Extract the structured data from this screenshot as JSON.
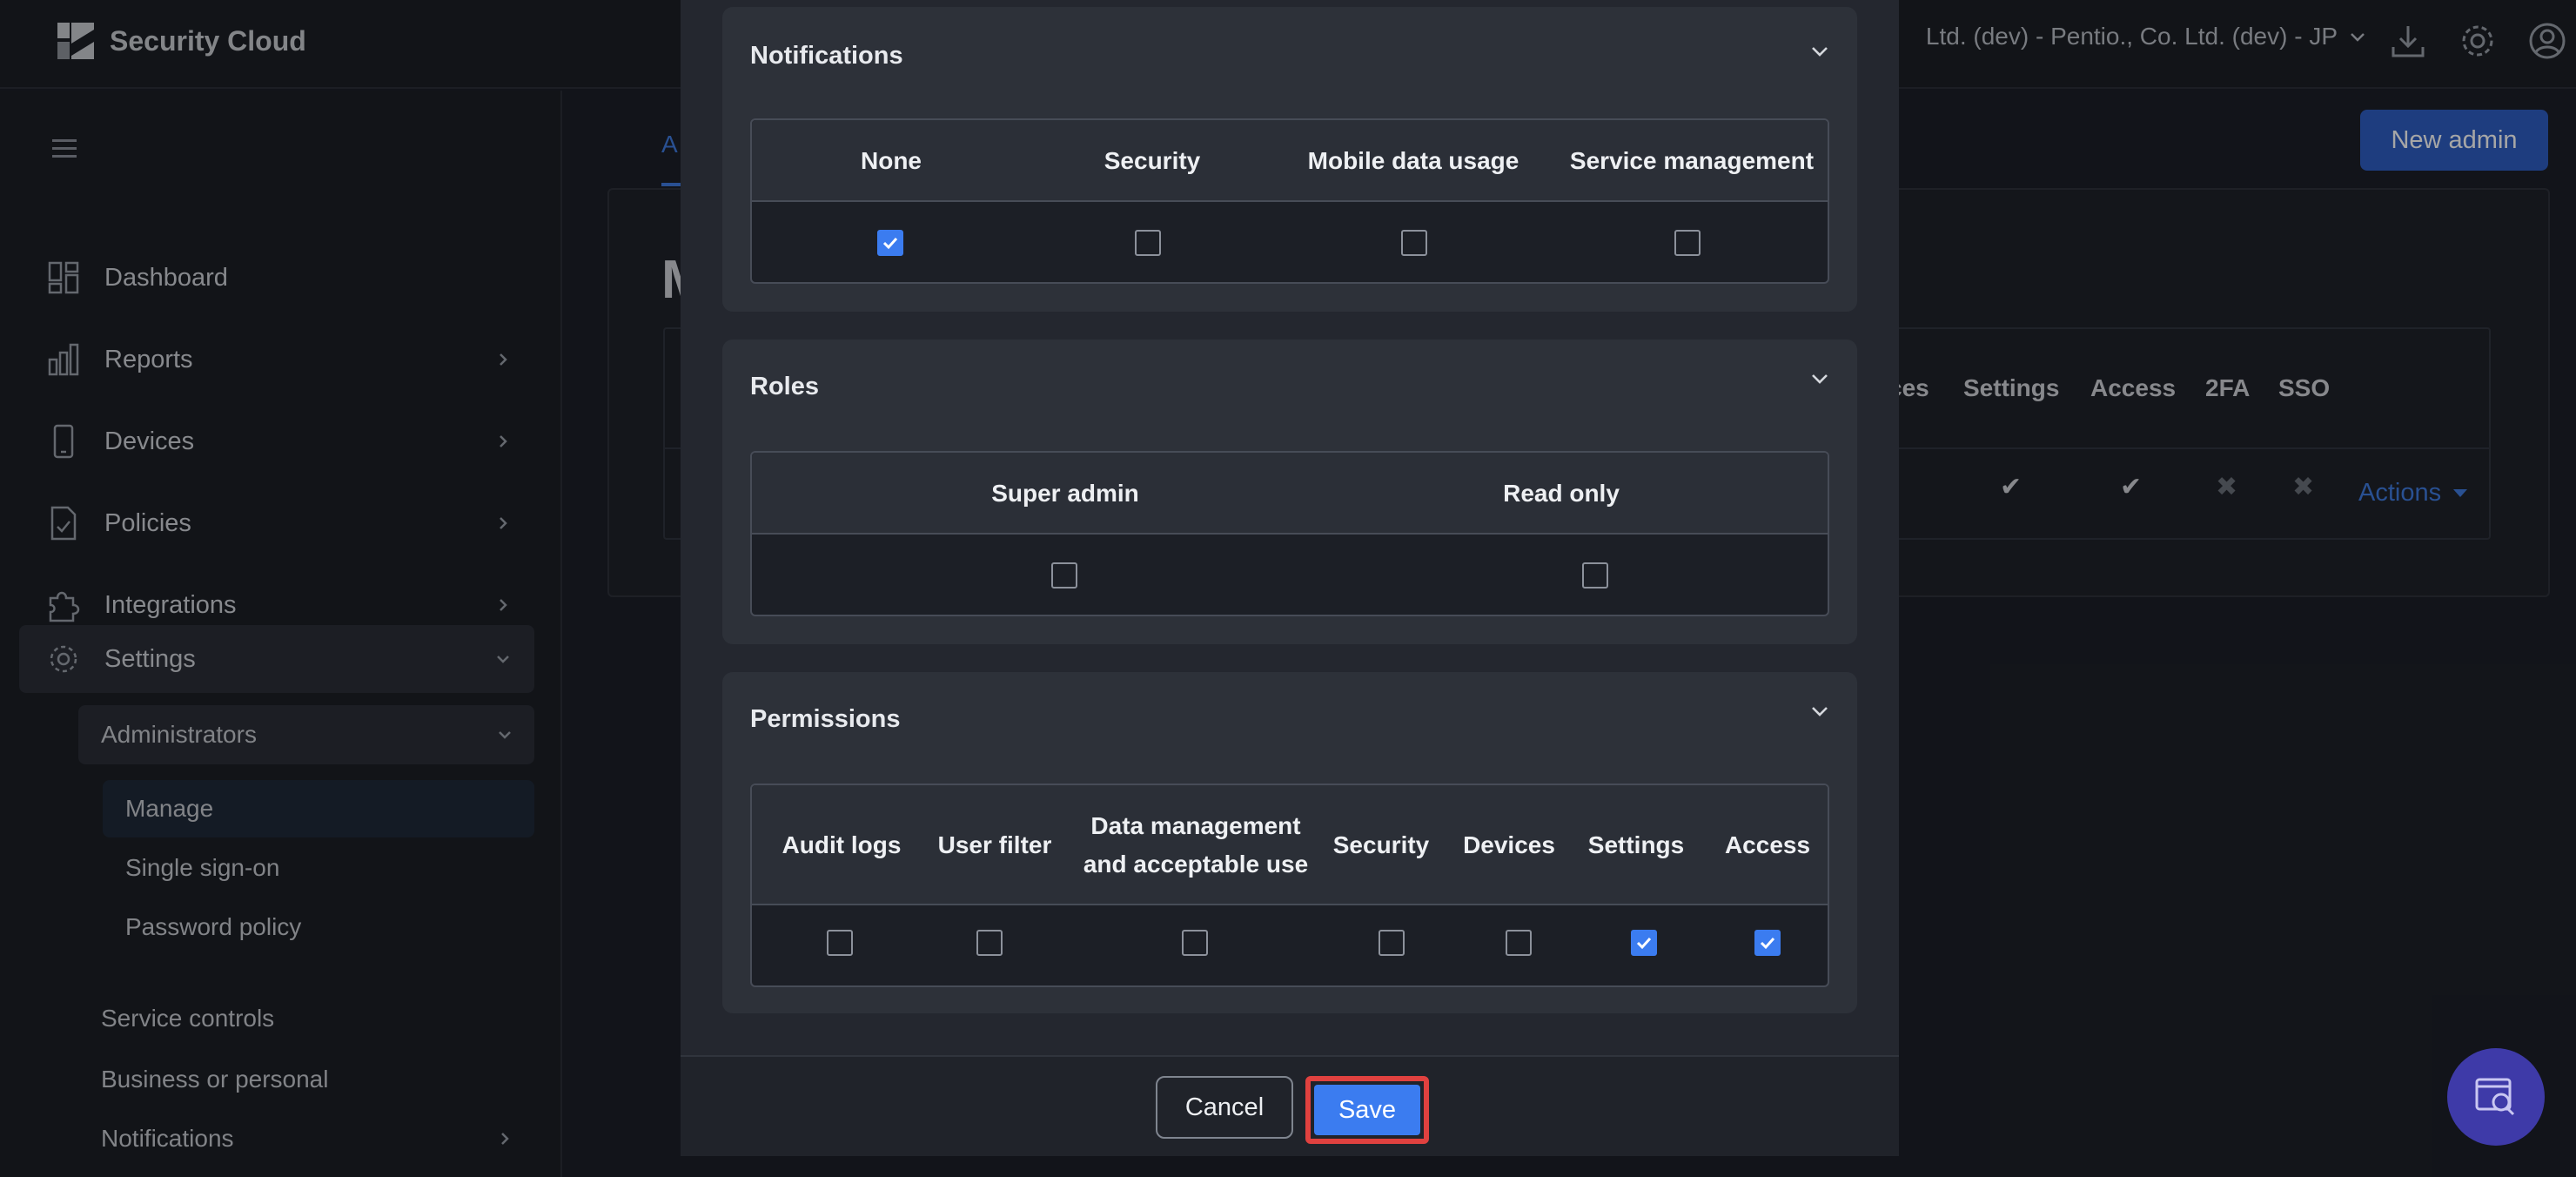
{
  "app": {
    "title": "Security Cloud"
  },
  "header": {
    "tenant": "Ltd. (dev) - Pentio., Co. Ltd. (dev) - JP"
  },
  "sidebar": {
    "items": [
      {
        "label": "Dashboard"
      },
      {
        "label": "Reports"
      },
      {
        "label": "Devices"
      },
      {
        "label": "Policies"
      },
      {
        "label": "Integrations"
      },
      {
        "label": "Settings"
      }
    ],
    "administrators": "Administrators",
    "admin_children": [
      "Manage",
      "Single sign-on",
      "Password policy"
    ],
    "more": [
      "Service controls",
      "Business or personal",
      "Notifications"
    ]
  },
  "main": {
    "tab": "A",
    "new_admin": "New admin",
    "title_fragment": "M",
    "columns": [
      "ces",
      "Settings",
      "Access",
      "2FA",
      "SSO"
    ],
    "row_marks": [
      "✔",
      "✔",
      "✖",
      "✖"
    ],
    "actions": "Actions"
  },
  "modal": {
    "notifications": {
      "title": "Notifications",
      "columns": [
        "None",
        "Security",
        "Mobile data usage",
        "Service management"
      ],
      "checked": [
        true,
        false,
        false,
        false
      ]
    },
    "roles": {
      "title": "Roles",
      "columns": [
        "Super admin",
        "Read only"
      ],
      "checked": [
        false,
        false
      ]
    },
    "permissions": {
      "title": "Permissions",
      "columns": [
        "Audit logs",
        "User filter",
        "Data management and acceptable use",
        "Security",
        "Devices",
        "Settings",
        "Access"
      ],
      "checked": [
        false,
        false,
        false,
        false,
        false,
        true,
        true
      ]
    },
    "cancel": "Cancel",
    "save": "Save"
  },
  "colors": {
    "accent": "#3b7cf0",
    "highlight": "#e0413f",
    "brand_button": "#2f5fc4"
  }
}
